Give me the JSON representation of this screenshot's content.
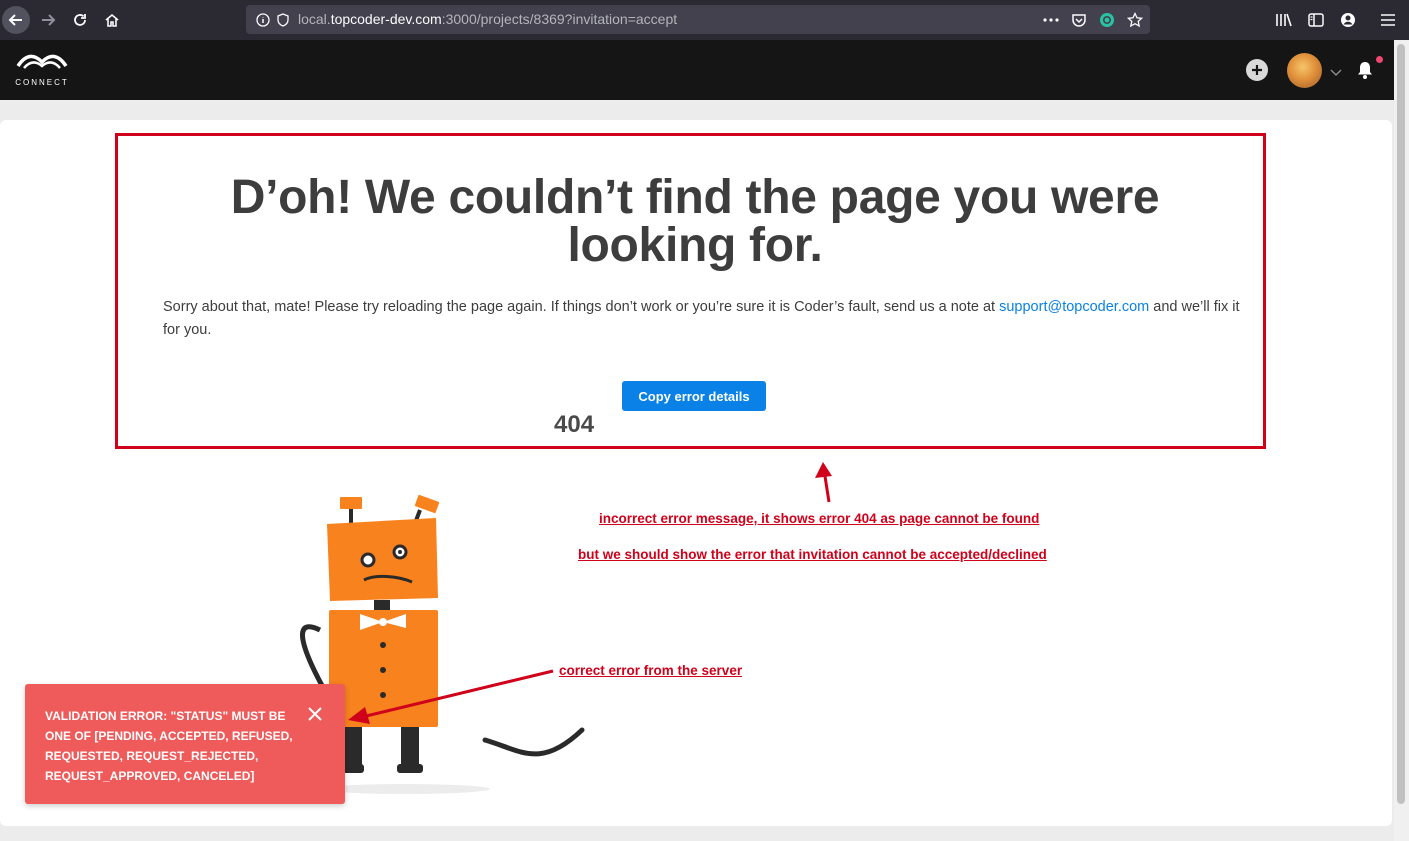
{
  "browser": {
    "url_prefix": "local.",
    "url_host": "topcoder-dev.com",
    "url_rest": ":3000/projects/8369?invitation=accept",
    "icons": [
      "back-icon",
      "forward-icon",
      "reload-icon",
      "home-icon",
      "info-icon",
      "shield-icon",
      "more-icon",
      "pocket-icon",
      "extension-icon",
      "bookmark-star-icon",
      "library-icon",
      "sidebar-icon",
      "account-icon",
      "menu-icon"
    ]
  },
  "header": {
    "logo_text": "CONNECT"
  },
  "error_page": {
    "title": "D’oh! We couldn’t find the page you were looking for.",
    "message_before": "Sorry about that, mate! Please try reloading the page again. If things don’t work or you’re sure it is Coder’s fault, send us a note at ",
    "support_email": "support@topcoder.com",
    "message_after": " and we’ll fix it for you.",
    "copy_button": "Copy error details",
    "error_code": "404"
  },
  "annotations": {
    "line1": "incorrect error message, it shows error 404 as page cannot be found",
    "line2": "but we should show the error that invitation cannot be accepted/declined",
    "line3": "correct error from the server"
  },
  "toast": {
    "message": "VALIDATION ERROR: \"STATUS\" MUST BE ONE OF [PENDING, ACCEPTED, REFUSED, REQUESTED, REQUEST_REJECTED, REQUEST_APPROVED, CANCELED]"
  },
  "colors": {
    "primary": "#0a81e6",
    "annotation_red": "#d0021b",
    "toast_bg": "#ef5a5a",
    "robot_orange": "#f7821e"
  }
}
